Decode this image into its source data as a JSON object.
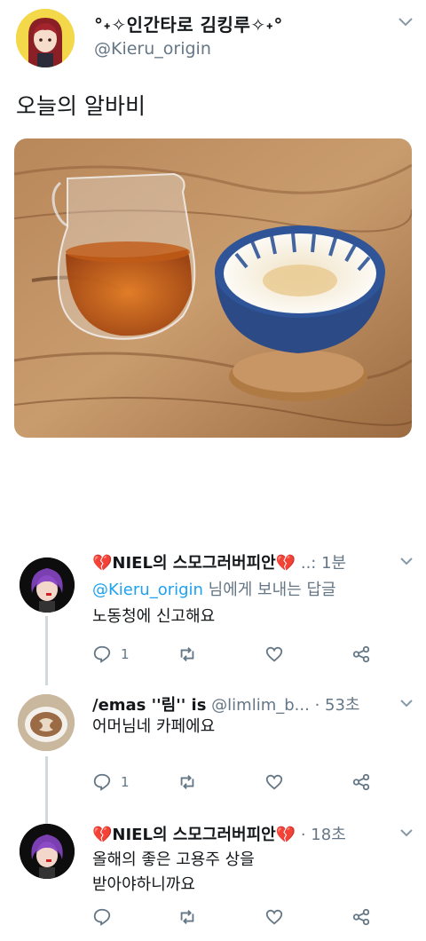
{
  "tweet": {
    "display_name": "°˖✧인간타로 김킹루✧˖°",
    "handle": "@Kieru_origin",
    "text": "오늘의 알바비"
  },
  "replies": [
    {
      "name": "💔NIEL의 스모그러버피안💔",
      "time": "..: 1분",
      "replying_prefix": "",
      "replying_handle": "@Kieru_origin",
      "replying_suffix": " 님에게 보내는 답글",
      "lines": [
        "노동청에 신고해요"
      ],
      "reply_count": "1"
    },
    {
      "name": "/emas ''림'' is",
      "handle": "@limlim_b...",
      "time": "· 53초",
      "lines": [
        "어머님네 카페에요"
      ],
      "reply_count": "1"
    },
    {
      "name": "💔NIEL의 스모그러버피안💔",
      "time": "· 18초",
      "lines": [
        "올해의 좋은 고용주 상을",
        "받아야하니까요"
      ],
      "reply_count": ""
    }
  ],
  "icons": {
    "reply": "reply-icon",
    "retweet": "retweet-icon",
    "like": "heart-icon",
    "share": "share-icon",
    "caret": "chevron-down-icon"
  },
  "colors": {
    "handle_gray": "#657786",
    "mention_blue": "#1da1f2",
    "thread_line": "#cfd9de"
  }
}
